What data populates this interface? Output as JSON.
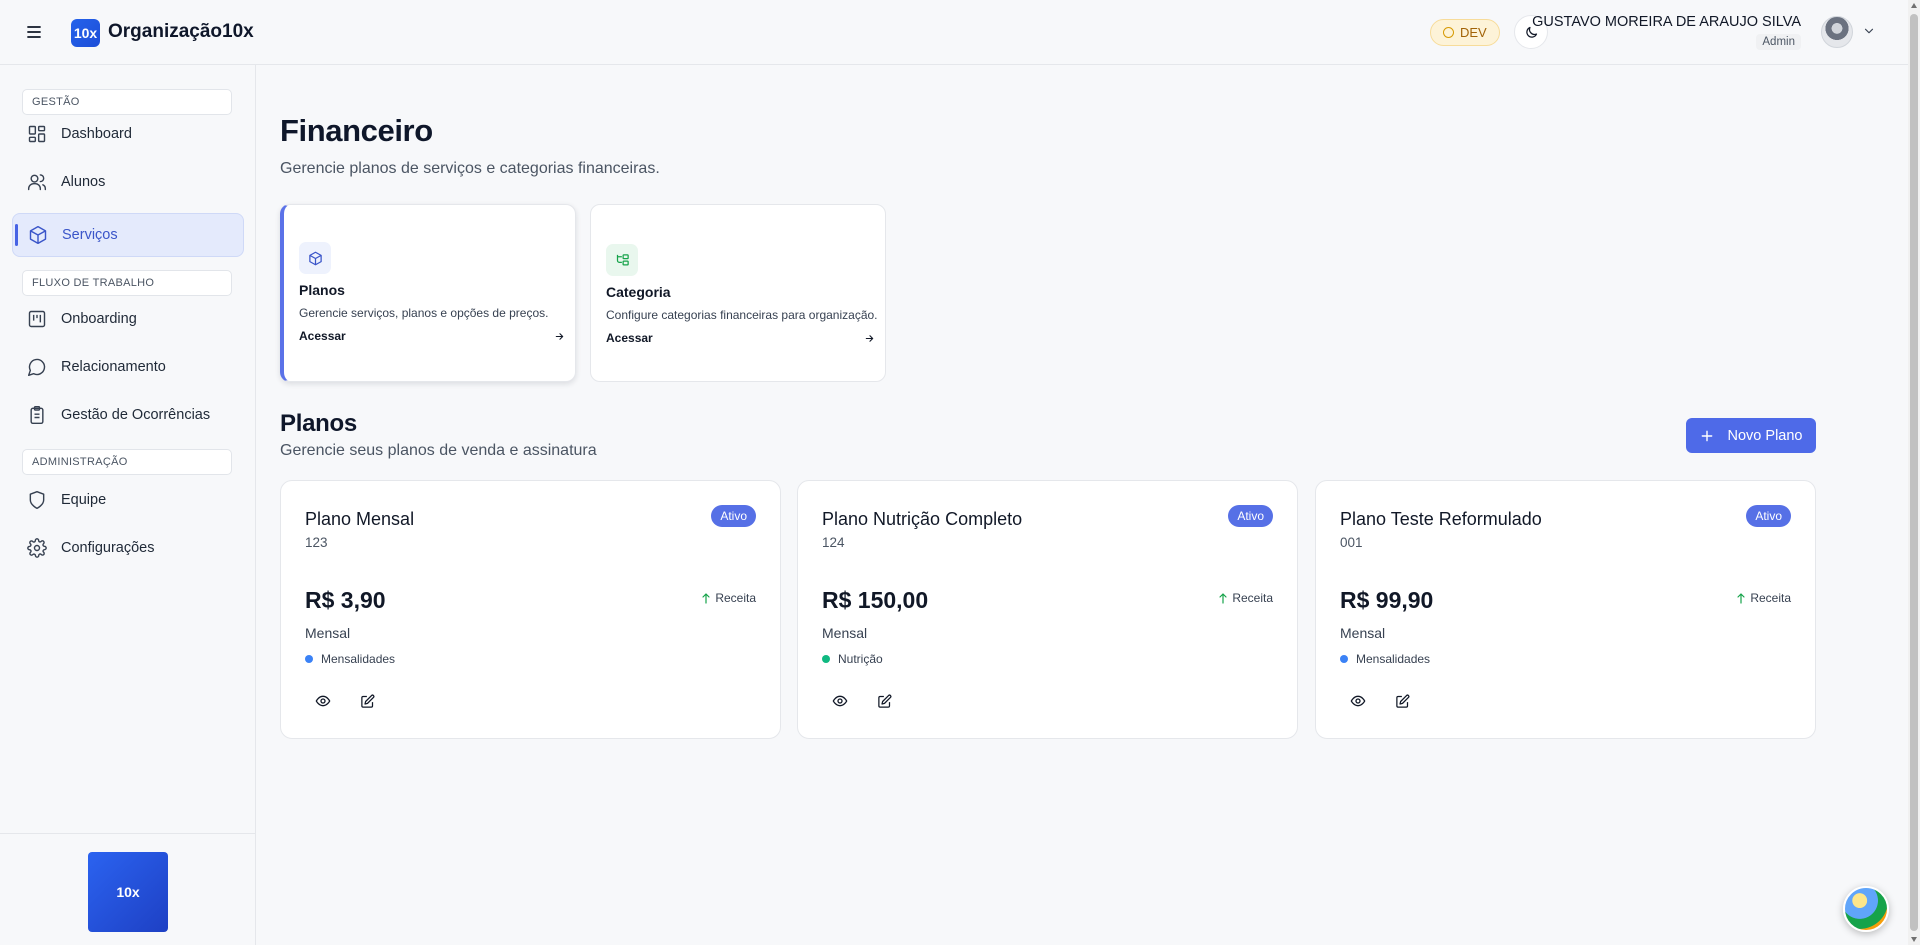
{
  "header": {
    "brand_logo_text": "10x",
    "brand_name": "Organização10x",
    "env_badge": "DEV",
    "user_name": "GUSTAVO MOREIRA DE ARAUJO SILVA",
    "user_role": "Admin"
  },
  "sidebar": {
    "sections": [
      {
        "label": "GESTÃO"
      },
      {
        "label": "FLUXO DE TRABALHO"
      },
      {
        "label": "ADMINISTRAÇÃO"
      }
    ],
    "items": [
      {
        "label": "Dashboard",
        "icon": "dashboard-icon"
      },
      {
        "label": "Alunos",
        "icon": "users-icon"
      },
      {
        "label": "Serviços",
        "icon": "package-icon",
        "active": true
      },
      {
        "label": "Onboarding",
        "icon": "kanban-icon"
      },
      {
        "label": "Relacionamento",
        "icon": "chat-icon"
      },
      {
        "label": "Gestão de Ocorrências",
        "icon": "clipboard-icon"
      },
      {
        "label": "Equipe",
        "icon": "shield-icon"
      },
      {
        "label": "Configurações",
        "icon": "gear-icon"
      }
    ],
    "footer_logo_text": "10x"
  },
  "main": {
    "title": "Financeiro",
    "subtitle": "Gerencie planos de serviços e categorias financeiras.",
    "quick_cards": [
      {
        "title": "Planos",
        "description": "Gerencie serviços, planos e opções de preços.",
        "link": "Acessar",
        "icon": "package-icon",
        "active": true
      },
      {
        "title": "Categoria",
        "description": "Configure categorias financeiras para organização.",
        "link": "Acessar",
        "icon": "category-tree-icon"
      }
    ],
    "plans_section": {
      "title": "Planos",
      "subtitle": "Gerencie seus planos de venda e assinatura",
      "new_button": "Novo Plano"
    },
    "plans": [
      {
        "name": "Plano Mensal",
        "code": "123",
        "status": "Ativo",
        "price": "R$ 3,90",
        "type": "Receita",
        "period": "Mensal",
        "category": "Mensalidades",
        "category_color": "#3b82f6"
      },
      {
        "name": "Plano Nutrição Completo",
        "code": "124",
        "status": "Ativo",
        "price": "R$ 150,00",
        "type": "Receita",
        "period": "Mensal",
        "category": "Nutrição",
        "category_color": "#10b981"
      },
      {
        "name": "Plano Teste Reformulado",
        "code": "001",
        "status": "Ativo",
        "price": "R$ 99,90",
        "type": "Receita",
        "period": "Mensal",
        "category": "Mensalidades",
        "category_color": "#3b82f6"
      }
    ]
  },
  "colors": {
    "accent": "#4e6ae8",
    "income_arrow": "#16a34a"
  }
}
